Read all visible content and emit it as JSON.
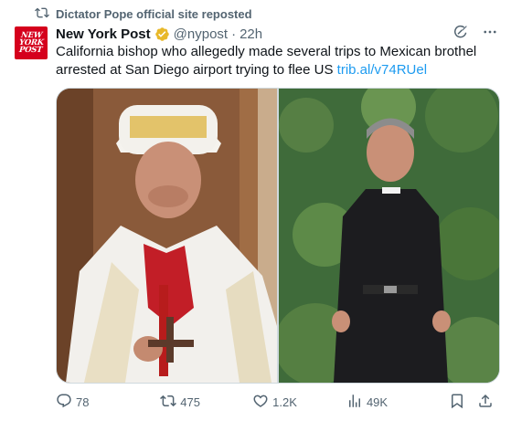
{
  "repost": {
    "label": "Dictator Pope official site reposted",
    "icon": "repost-icon"
  },
  "post": {
    "avatar_text": [
      "NEW",
      "YORK",
      "POST"
    ],
    "author_name": "New York Post",
    "verified_icon": "verified-badge-icon",
    "handle": "@nypost",
    "separator": "·",
    "time": "22h",
    "text": "California bishop who allegedly made several trips to Mexican brothel arrested at San Diego airport trying to flee US ",
    "link": "trib.al/v74RUel"
  },
  "actions": {
    "replies": "78",
    "reposts": "475",
    "likes": "1.2K",
    "views": "49K"
  },
  "colors": {
    "brand_red": "#d5001c",
    "link_blue": "#1d9bf0",
    "muted_gray": "#536471",
    "gold_badge": "#e8b829"
  }
}
